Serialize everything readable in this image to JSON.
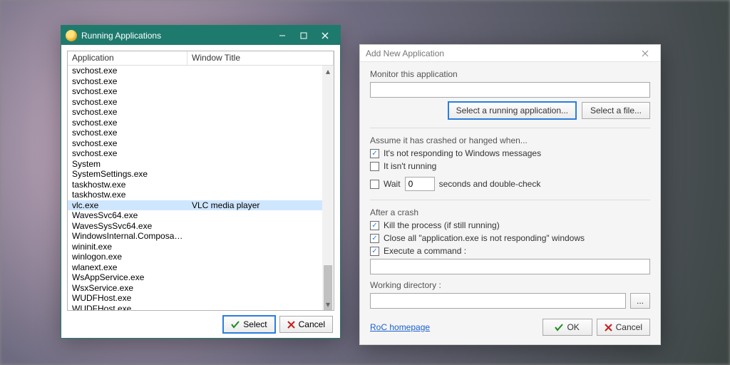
{
  "running_apps": {
    "title": "Running Applications",
    "columns": {
      "app": "Application",
      "win": "Window Title"
    },
    "rows": [
      {
        "app": "svchost.exe",
        "win": ""
      },
      {
        "app": "svchost.exe",
        "win": ""
      },
      {
        "app": "svchost.exe",
        "win": ""
      },
      {
        "app": "svchost.exe",
        "win": ""
      },
      {
        "app": "svchost.exe",
        "win": ""
      },
      {
        "app": "svchost.exe",
        "win": ""
      },
      {
        "app": "svchost.exe",
        "win": ""
      },
      {
        "app": "svchost.exe",
        "win": ""
      },
      {
        "app": "svchost.exe",
        "win": ""
      },
      {
        "app": "System",
        "win": ""
      },
      {
        "app": "SystemSettings.exe",
        "win": ""
      },
      {
        "app": "taskhostw.exe",
        "win": ""
      },
      {
        "app": "taskhostw.exe",
        "win": ""
      },
      {
        "app": "vlc.exe",
        "win": "VLC media player",
        "selected": true
      },
      {
        "app": "WavesSvc64.exe",
        "win": ""
      },
      {
        "app": "WavesSysSvc64.exe",
        "win": ""
      },
      {
        "app": "WindowsInternal.ComposableShell.E...",
        "win": ""
      },
      {
        "app": "wininit.exe",
        "win": ""
      },
      {
        "app": "winlogon.exe",
        "win": ""
      },
      {
        "app": "wlanext.exe",
        "win": ""
      },
      {
        "app": "WsAppService.exe",
        "win": ""
      },
      {
        "app": "WsxService.exe",
        "win": ""
      },
      {
        "app": "WUDFHost.exe",
        "win": ""
      },
      {
        "app": "WUDFHost.exe",
        "win": ""
      }
    ],
    "select": "Select",
    "cancel": "Cancel"
  },
  "add_app": {
    "title": "Add New Application",
    "monitor_label": "Monitor this application",
    "monitor_value": "",
    "select_running": "Select a running application...",
    "select_file": "Select a file...",
    "assume_label": "Assume it has crashed or hanged when...",
    "chk_notresp": {
      "checked": true,
      "label": "It's not responding to Windows messages"
    },
    "chk_notrun": {
      "checked": false,
      "label": "It isn't running"
    },
    "wait": {
      "checked": false,
      "label_pre": "Wait",
      "value": "0",
      "label_post": "seconds and double-check"
    },
    "after_label": "After a crash",
    "chk_kill": {
      "checked": true,
      "label": "Kill the process (if still running)"
    },
    "chk_close": {
      "checked": true,
      "label": "Close all \"application.exe is not responding\" windows"
    },
    "chk_exec": {
      "checked": true,
      "label": "Execute a command :"
    },
    "exec_value": "",
    "workdir_label": "Working directory :",
    "workdir_value": "",
    "browse": "...",
    "homepage": "RoC homepage",
    "ok": "OK",
    "cancel": "Cancel"
  }
}
